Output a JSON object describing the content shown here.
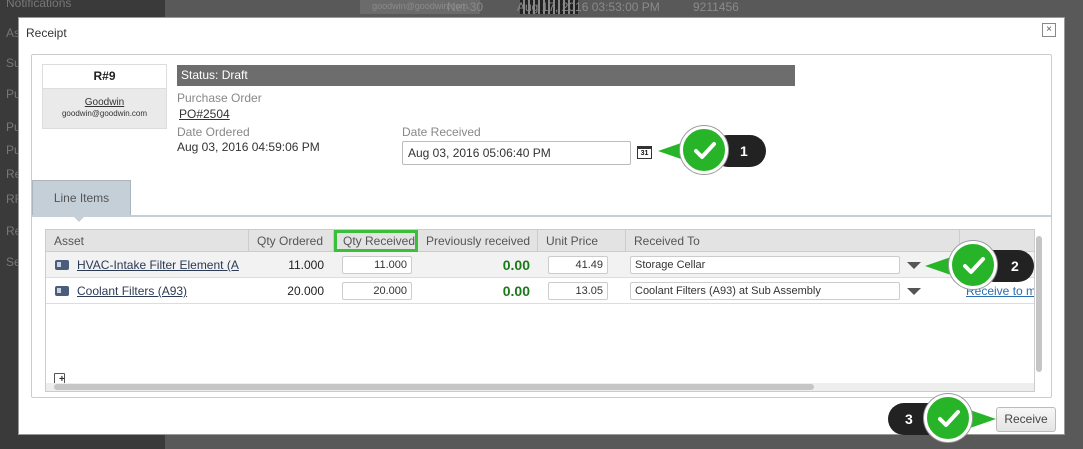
{
  "background": {
    "nav_items": [
      "Notifications",
      "As",
      "Su",
      "Pu",
      "Pu",
      "Pu",
      "Re",
      "RF",
      "Re",
      "Se"
    ],
    "row_email": "goodwin@goodwin.com",
    "row_terms": "Net-30",
    "row_date": "Aug 17, 2016 03:53:00 PM",
    "row_id": "9211456"
  },
  "modal": {
    "title": "Receipt",
    "close_label": "×",
    "vendor": {
      "receipt_no": "R#9",
      "name": "Goodwin",
      "email": "goodwin@goodwin.com"
    },
    "status_label": "Status: Draft",
    "purchase_order": {
      "label": "Purchase Order",
      "value": "PO#2504"
    },
    "date_ordered": {
      "label": "Date Ordered",
      "value": "Aug 03, 2016 04:59:06 PM"
    },
    "date_received": {
      "label": "Date Received",
      "value": "Aug 03, 2016 05:06:40 PM",
      "calendar_glyph": "31"
    },
    "tab_label": "Line Items",
    "grid": {
      "columns": [
        "Asset",
        "Qty Ordered",
        "Qty Received",
        "Previously received",
        "Unit Price",
        "Received To"
      ],
      "rows": [
        {
          "asset": "HVAC-Intake Filter Element (A",
          "qty_ordered": "11.000",
          "qty_received": "11.000",
          "prev_received": "0.00",
          "unit_price": "41.49",
          "received_to": "Storage Cellar",
          "action": ""
        },
        {
          "asset": "Coolant Filters (A93)",
          "qty_ordered": "20.000",
          "qty_received": "20.000",
          "prev_received": "0.00",
          "unit_price": "13.05",
          "received_to": "Coolant Filters (A93) at Sub Assembly",
          "action": "Receive to m"
        }
      ]
    },
    "receive_button": "Receive"
  },
  "callouts": [
    {
      "number": "1"
    },
    {
      "number": "2"
    },
    {
      "number": "3"
    }
  ],
  "colors": {
    "accent_green": "#28b428",
    "status_bar": "#6d6d6d",
    "tab": "#c5cfd8",
    "prev_received": "#1a7a1a"
  }
}
